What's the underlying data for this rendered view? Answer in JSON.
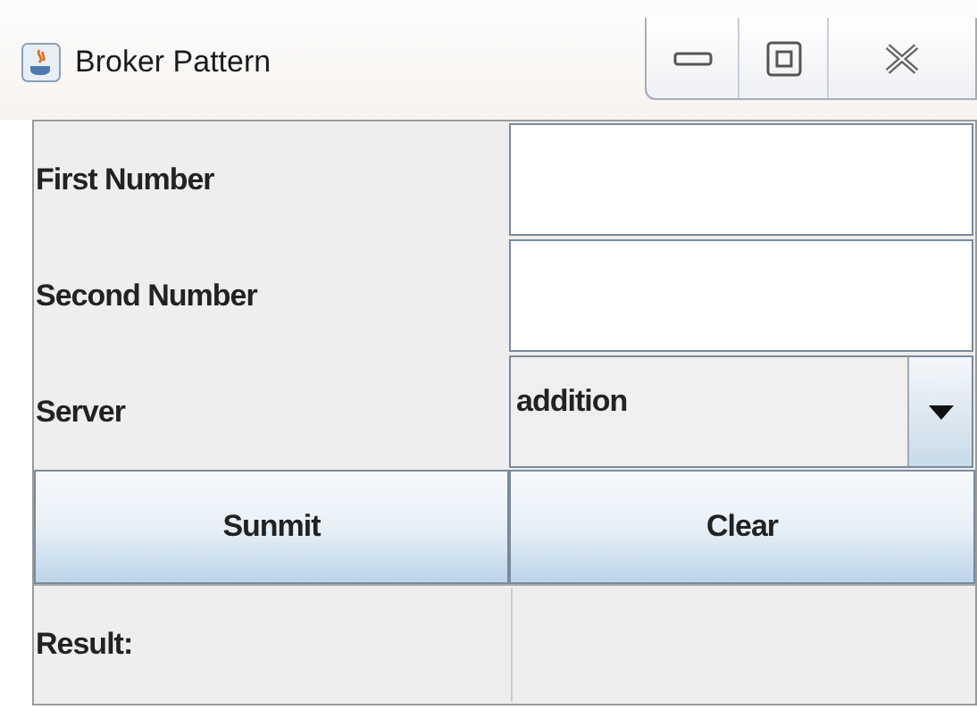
{
  "window": {
    "title": "Broker Pattern"
  },
  "fields": [
    {
      "label": "First Number"
    },
    {
      "label": "Second Number"
    }
  ],
  "server": {
    "label": "Server",
    "value": "addition"
  },
  "buttons": [
    "Sunmit",
    "Clear"
  ],
  "result": {
    "label": "Result:"
  }
}
